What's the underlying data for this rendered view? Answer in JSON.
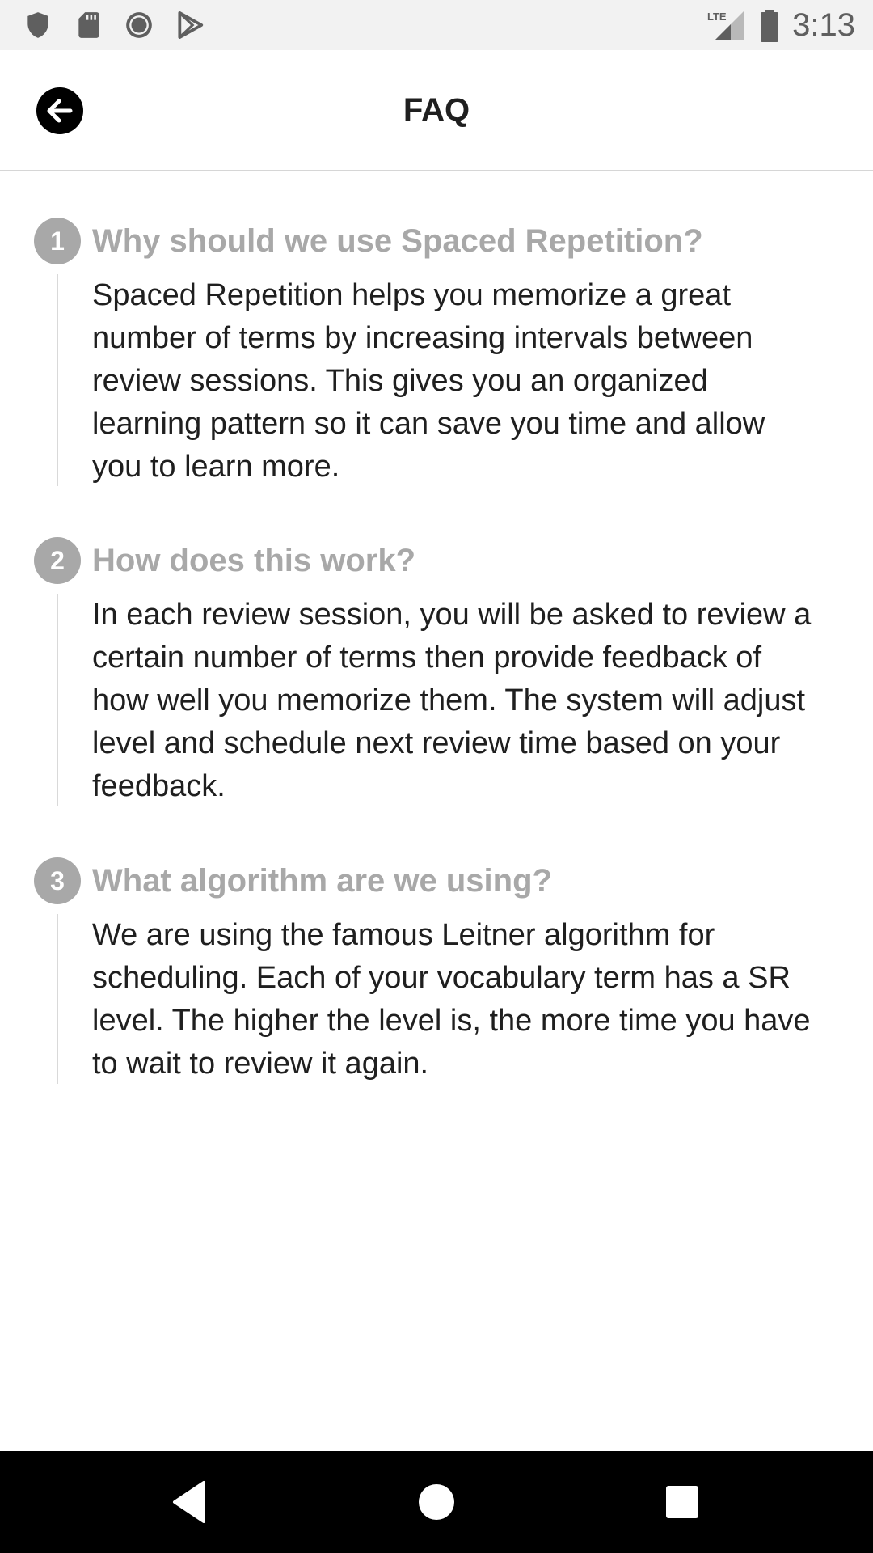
{
  "status_bar": {
    "time": "3:13",
    "network": "LTE",
    "icons": [
      "shield-icon",
      "sd-card-icon",
      "record-icon",
      "play-store-icon",
      "lte-signal-icon",
      "battery-icon"
    ]
  },
  "app_bar": {
    "title": "FAQ",
    "back_icon": "arrow-left-icon"
  },
  "faq": {
    "items": [
      {
        "number": "1",
        "question": "Why should we use Spaced Repetition?",
        "answer": "Spaced Repetition helps you memorize a great number of terms by increasing intervals between review sessions. This gives you an organized learning pattern so it can save you time and allow you to learn more."
      },
      {
        "number": "2",
        "question": "How does this work?",
        "answer": "In each review session, you will be asked to review a certain number of terms then provide feedback of how well you memorize them. The system will adjust level and schedule next review time based on your feedback."
      },
      {
        "number": "3",
        "question": "What algorithm are we using?",
        "answer": "We are using the famous Leitner algorithm for scheduling. Each of your vocabulary term has a SR level. The higher the level is, the more time you have to wait to review it again."
      }
    ]
  },
  "nav_bar": {
    "icons": [
      "back-triangle-icon",
      "home-circle-icon",
      "recents-square-icon"
    ]
  },
  "colors": {
    "status_bar_bg": "#f2f2f2",
    "status_icon": "#5f5f5f",
    "accent_gray": "#a8a8a8",
    "body_text": "#1f1f1f",
    "nav_bar_bg": "#000000"
  }
}
